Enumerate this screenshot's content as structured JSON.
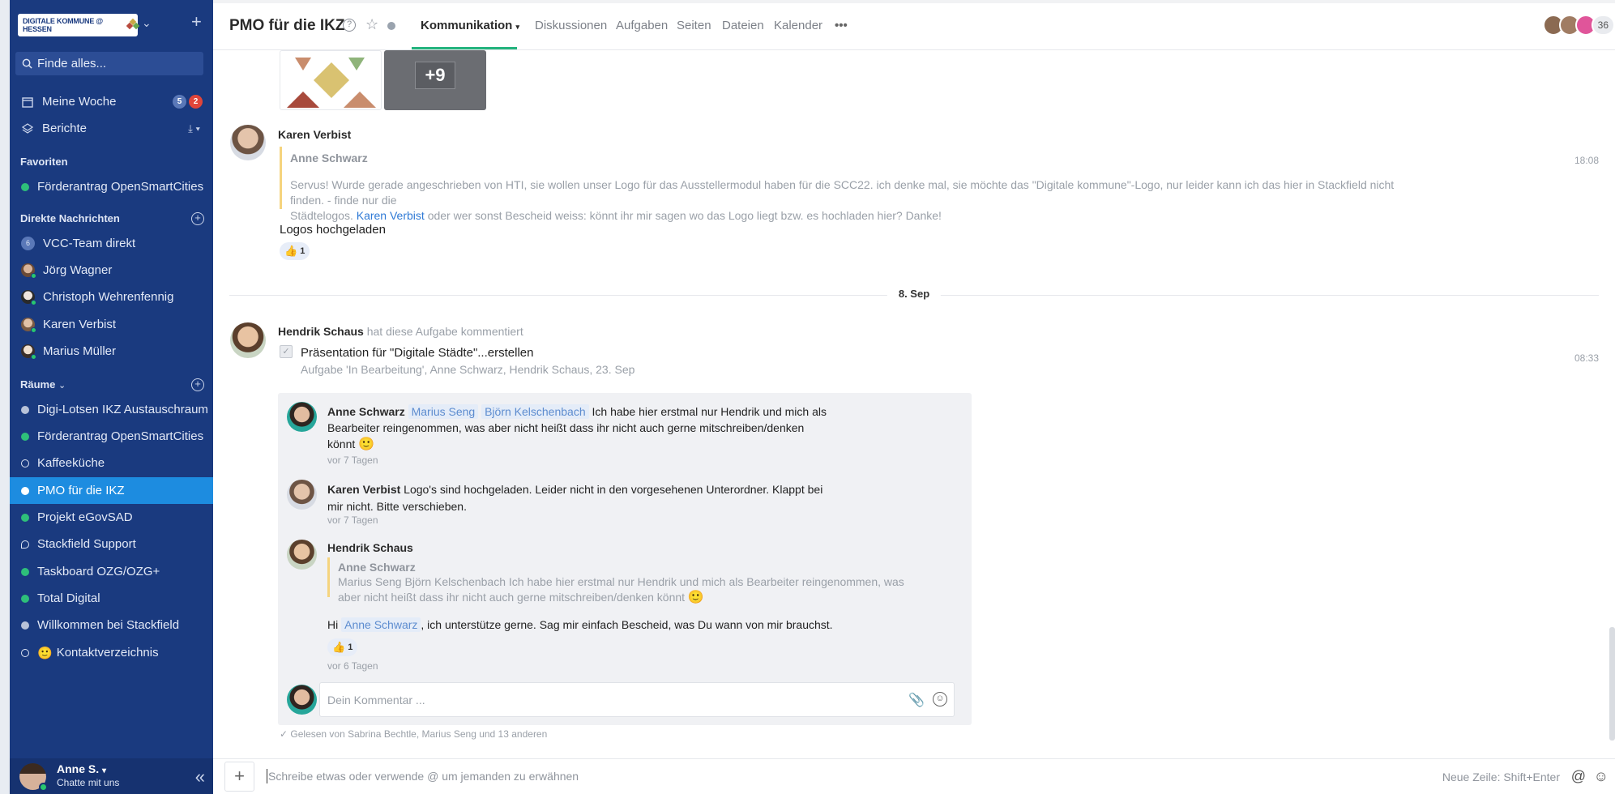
{
  "sidebar": {
    "logo_text": "DIGITALE KOMMUNE @ HESSEN",
    "search_placeholder": "Finde alles...",
    "nav": [
      {
        "label": "Meine Woche",
        "badges": [
          "5",
          "2"
        ]
      },
      {
        "label": "Berichte"
      }
    ],
    "favorites_head": "Favoriten",
    "favorites": [
      {
        "label": "Förderantrag OpenSmartCities",
        "status": "#2ec07a"
      }
    ],
    "dm_head": "Direkte Nachrichten",
    "dms": [
      {
        "label": "VCC-Team direkt",
        "initial": "6"
      },
      {
        "label": "Jörg Wagner"
      },
      {
        "label": "Christoph Wehrenfennig"
      },
      {
        "label": "Karen Verbist"
      },
      {
        "label": "Marius Müller"
      }
    ],
    "rooms_head": "Räume",
    "rooms": [
      {
        "label": "Digi-Lotsen IKZ Austauschraum",
        "status": "#b8c2d8"
      },
      {
        "label": "Förderantrag OpenSmartCities",
        "status": "#2ec07a"
      },
      {
        "label": "Kaffeeküche",
        "status": "hollow"
      },
      {
        "label": "PMO für die IKZ",
        "status": "#ffffff",
        "active": true
      },
      {
        "label": "Projekt eGovSAD",
        "status": "#2ec07a"
      },
      {
        "label": "Stackfield Support",
        "status": "chat"
      },
      {
        "label": "Taskboard OZG/OZG+",
        "status": "#2ec07a"
      },
      {
        "label": "Total Digital",
        "status": "#2ec07a"
      },
      {
        "label": "Willkommen bei Stackfield",
        "status": "#b8c2d8"
      },
      {
        "label": "Kontaktverzeichnis",
        "status": "hollow"
      }
    ],
    "user": {
      "name": "Anne S.",
      "status": "Chatte mit uns"
    }
  },
  "header": {
    "title": "PMO für die IKZ",
    "tabs": [
      "Kommunikation",
      "Diskussionen",
      "Aufgaben",
      "Seiten",
      "Dateien",
      "Kalender"
    ],
    "member_count": "36"
  },
  "feed": {
    "thumb_more": "+9",
    "post1": {
      "author": "Karen Verbist",
      "quote_author": "Anne Schwarz",
      "quote_text_a": "Servus! Wurde gerade angeschrieben von HTI, sie wollen unser Logo für das Ausstellermodul haben für die SCC22. ich denke mal, sie möchte das \"Digitale kommune\"-Logo, nur leider kann ich das hier in Stackfield nicht finden. - finde nur die",
      "quote_text_b": "Städtelogos.",
      "quote_mention": "Karen Verbist",
      "quote_text_c": "oder wer sonst Bescheid weiss: könnt ihr mir sagen wo das Logo liegt bzw. es hochladen hier? Danke!",
      "time": "18:08",
      "body": "Logos hochgeladen",
      "reaction": "1"
    },
    "date_sep": "8. Sep",
    "post2": {
      "author": "Hendrik Schaus",
      "action": "hat diese Aufgabe kommentiert",
      "task": "Präsentation für \"Digitale Städte\"...erstellen",
      "task_meta": "Aufgabe 'In Bearbeitung', Anne Schwarz, Hendrik Schaus, 23. Sep",
      "time": "08:33"
    },
    "comments": [
      {
        "author": "Anne Schwarz",
        "mentions": [
          "Marius Seng",
          "Björn Kelschenbach"
        ],
        "text_a": "Ich habe hier erstmal nur Hendrik und mich als",
        "text_b": "Bearbeiter reingenommen, was aber nicht heißt dass ihr nicht auch gerne mitschreiben/denken",
        "text_c": "könnt",
        "ago": "vor 7 Tagen"
      },
      {
        "author": "Karen Verbist",
        "text_a": "Logo's sind hochgeladen. Leider nicht in den vorgesehenen Unterordner. Klappt bei",
        "text_b": "mir nicht. Bitte verschieben.",
        "ago": "vor 7 Tagen"
      },
      {
        "author": "Hendrik Schaus",
        "quote_author": "Anne Schwarz",
        "quote_a": "Marius Seng Björn Kelschenbach  Ich habe hier erstmal nur Hendrik und mich als Bearbeiter reingenommen, was",
        "quote_b": "aber nicht heißt dass ihr nicht auch gerne mitschreiben/denken könnt",
        "text_pre": "Hi",
        "mention": "Anne Schwarz",
        "text_post": ", ich unterstütze gerne. Sag mir einfach Bescheid,  was Du wann von mir brauchst.",
        "reaction": "1",
        "ago": "vor 6 Tagen"
      }
    ],
    "comment_placeholder": "Dein Kommentar ...",
    "read_by": "Gelesen von Sabrina Bechtle, Marius Seng und 13 anderen"
  },
  "composer": {
    "placeholder": "Schreibe etwas oder verwende @ um jemanden zu erwähnen",
    "hint": "Neue Zeile: Shift+Enter"
  }
}
